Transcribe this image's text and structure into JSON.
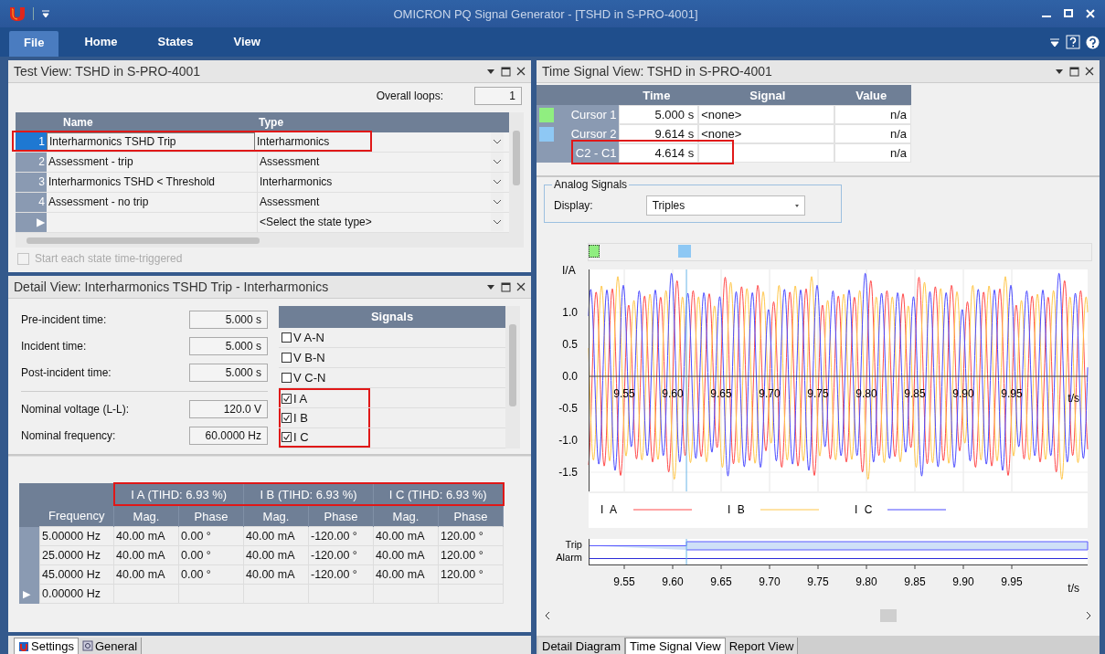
{
  "window": {
    "title": "OMICRON PQ Signal Generator - [TSHD in S-PRO-4001]"
  },
  "ribbon_tabs": [
    {
      "label": "File",
      "selected": true
    },
    {
      "label": "Home",
      "selected": false
    },
    {
      "label": "States",
      "selected": false
    },
    {
      "label": "View",
      "selected": false
    }
  ],
  "test_view": {
    "title": "Test View: TSHD in S-PRO-4001",
    "loops_label": "Overall loops:",
    "loops_value": "1",
    "columns": [
      "Name",
      "Type"
    ],
    "rows": [
      {
        "kind": "state",
        "number": "1",
        "name": "Interharmonics TSHD Trip",
        "type": "Interharmonics",
        "selected": true,
        "highlighted": true
      },
      {
        "kind": "state",
        "number": "2",
        "name": "Assessment - trip",
        "type": "Assessment",
        "selected": false,
        "highlighted": false
      },
      {
        "kind": "state",
        "number": "3",
        "name": "Interharmonics TSHD < Threshold",
        "type": "Interharmonics",
        "selected": false,
        "highlighted": false
      },
      {
        "kind": "state",
        "number": "4",
        "name": "Assessment - no trip",
        "type": "Assessment",
        "selected": false,
        "highlighted": false
      },
      {
        "kind": "new",
        "number": "▶",
        "type": "<Select the state type>",
        "selected": false,
        "highlighted": false
      }
    ],
    "time_triggered": {
      "label": "Start each state time-triggered",
      "checked": false,
      "disabled": true
    }
  },
  "detail_view": {
    "title": "Detail View: Interharmonics TSHD Trip - Interharmonics",
    "fields": [
      {
        "label": "Pre-incident time:",
        "value": "5.000 s"
      },
      {
        "label": "Incident time:",
        "value": "5.000 s"
      },
      {
        "label": "Post-incident time:",
        "value": "5.000 s"
      },
      {
        "label": "Nominal voltage (L-L):",
        "value": "120.0 V"
      },
      {
        "label": "Nominal frequency:",
        "value": "60.0000 Hz"
      }
    ],
    "signals_header": "Signals",
    "signals": [
      {
        "label": "V A-N",
        "checked": false,
        "highlighted": false
      },
      {
        "label": "V B-N",
        "checked": false,
        "highlighted": false
      },
      {
        "label": "V C-N",
        "checked": false,
        "highlighted": false
      },
      {
        "label": "I A",
        "checked": true,
        "highlighted": true
      },
      {
        "label": "I B",
        "checked": true,
        "highlighted": true
      },
      {
        "label": "I C",
        "checked": true,
        "highlighted": true
      }
    ]
  },
  "harmonics": {
    "groups": [
      {
        "label": "I A (TIHD: 6.93 %)",
        "highlighted": true
      },
      {
        "label": "I B (TIHD: 6.93 %)",
        "highlighted": true
      },
      {
        "label": "I C (TIHD: 6.93 %)",
        "highlighted": true
      }
    ],
    "columns": [
      "Frequency",
      "Mag.",
      "Phase",
      "Mag.",
      "Phase",
      "Mag.",
      "Phase"
    ],
    "rows": [
      {
        "cells": [
          "5.00000 Hz",
          "40.00 mA",
          "0.00 °",
          "40.00 mA",
          "-120.00 °",
          "40.00 mA",
          "120.00 °"
        ]
      },
      {
        "cells": [
          "25.0000 Hz",
          "40.00 mA",
          "0.00 °",
          "40.00 mA",
          "-120.00 °",
          "40.00 mA",
          "120.00 °"
        ]
      },
      {
        "cells": [
          "45.0000 Hz",
          "40.00 mA",
          "0.00 °",
          "40.00 mA",
          "-120.00 °",
          "40.00 mA",
          "120.00 °"
        ]
      },
      {
        "marker": "▶",
        "cells": [
          "0.00000 Hz"
        ]
      }
    ]
  },
  "left_tabs": [
    {
      "label": "Settings",
      "selected": true
    },
    {
      "label": "General",
      "selected": false
    }
  ],
  "time_signal_view": {
    "title": "Time Signal View: TSHD in S-PRO-4001",
    "columns": [
      "Time",
      "Signal",
      "Value"
    ],
    "cursors": [
      {
        "label": "Cursor 1",
        "color": "#90ee80",
        "time": "5.000 s",
        "signal": "<none>",
        "value": "n/a",
        "highlighted": false
      },
      {
        "label": "Cursor 2",
        "color": "#8ec8f4",
        "time": "9.614 s",
        "signal": "<none>",
        "value": "n/a",
        "highlighted": false
      },
      {
        "label": "C2 - C1",
        "time": "4.614 s",
        "value": "n/a",
        "highlighted": true
      }
    ],
    "analog": {
      "legend": "Analog Signals",
      "display_label": "Display:",
      "display_value": "Triples"
    },
    "chart": {
      "ylabel": "I/A",
      "yticks": [
        "1.0",
        "0.5",
        "0.0",
        "-0.5",
        "-1.0",
        "-1.5"
      ],
      "xticks": [
        "9.55",
        "9.60",
        "9.65",
        "9.70",
        "9.75",
        "9.80",
        "9.85",
        "9.90",
        "9.95"
      ],
      "xlabel": "t/s",
      "series": [
        {
          "label": "I A",
          "color": "#ff4b4b"
        },
        {
          "label": "I B",
          "color": "#ffc74a"
        },
        {
          "label": "I C",
          "color": "#4b4bff"
        }
      ]
    },
    "binary": {
      "signals": [
        "Trip",
        "Alarm"
      ],
      "xticks": [
        "9.55",
        "9.60",
        "9.65",
        "9.70",
        "9.75",
        "9.80",
        "9.85",
        "9.90",
        "9.95"
      ],
      "xlabel": "t/s"
    }
  },
  "right_tabs": [
    {
      "label": "Detail Diagram",
      "selected": false
    },
    {
      "label": "Time Signal View",
      "selected": true
    },
    {
      "label": "Report View",
      "selected": false
    }
  ]
}
